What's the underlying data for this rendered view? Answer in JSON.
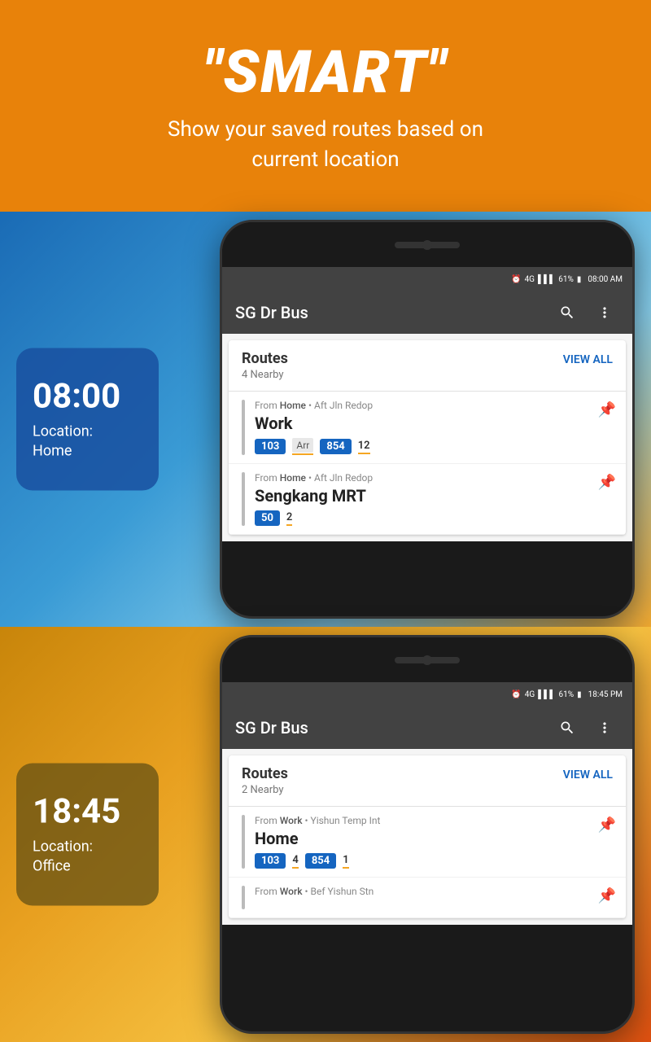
{
  "header": {
    "title": "\"SMART\"",
    "subtitle": "Show your saved routes based on\ncurrent location"
  },
  "top_section": {
    "time": "08:00",
    "location_label": "Location:",
    "location_value": "Home",
    "phone": {
      "status_bar": {
        "icons": "⏰ 4G ▌▌▌ 61%",
        "battery": "🔋",
        "time": "08:00 AM"
      },
      "app_title": "SG Dr Bus",
      "routes": {
        "title": "Routes",
        "subtitle": "4 Nearby",
        "view_all": "VIEW ALL",
        "items": [
          {
            "from_label": "From",
            "from": "Home",
            "via": "Aft Jln Redop",
            "destination": "Work",
            "buses": [
              {
                "number": "103",
                "time": "Arr",
                "has_underline": true
              },
              {
                "number": "854",
                "time": "12",
                "has_underline": true
              }
            ]
          },
          {
            "from_label": "From",
            "from": "Home",
            "via": "Aft Jln Redop",
            "destination": "Sengkang MRT",
            "buses": [
              {
                "number": "50",
                "time": "2",
                "has_underline": true
              }
            ]
          }
        ]
      }
    }
  },
  "bottom_section": {
    "time": "18:45",
    "location_label": "Location:",
    "location_value": "Office",
    "phone": {
      "status_bar": {
        "icons": "⏰ 4G ▌▌▌ 61%",
        "battery": "🔋",
        "time": "18:45 PM"
      },
      "app_title": "SG Dr Bus",
      "routes": {
        "title": "Routes",
        "subtitle": "2 Nearby",
        "view_all": "VIEW ALL",
        "items": [
          {
            "from_label": "From",
            "from": "Work",
            "via": "Yishun Temp Int",
            "destination": "Home",
            "buses": [
              {
                "number": "103",
                "time": "4",
                "has_underline": true
              },
              {
                "number": "854",
                "time": "1",
                "has_underline": true
              }
            ]
          },
          {
            "from_label": "From",
            "from": "Work",
            "via": "Bef Yishun Stn",
            "destination": "",
            "buses": []
          }
        ]
      }
    }
  }
}
